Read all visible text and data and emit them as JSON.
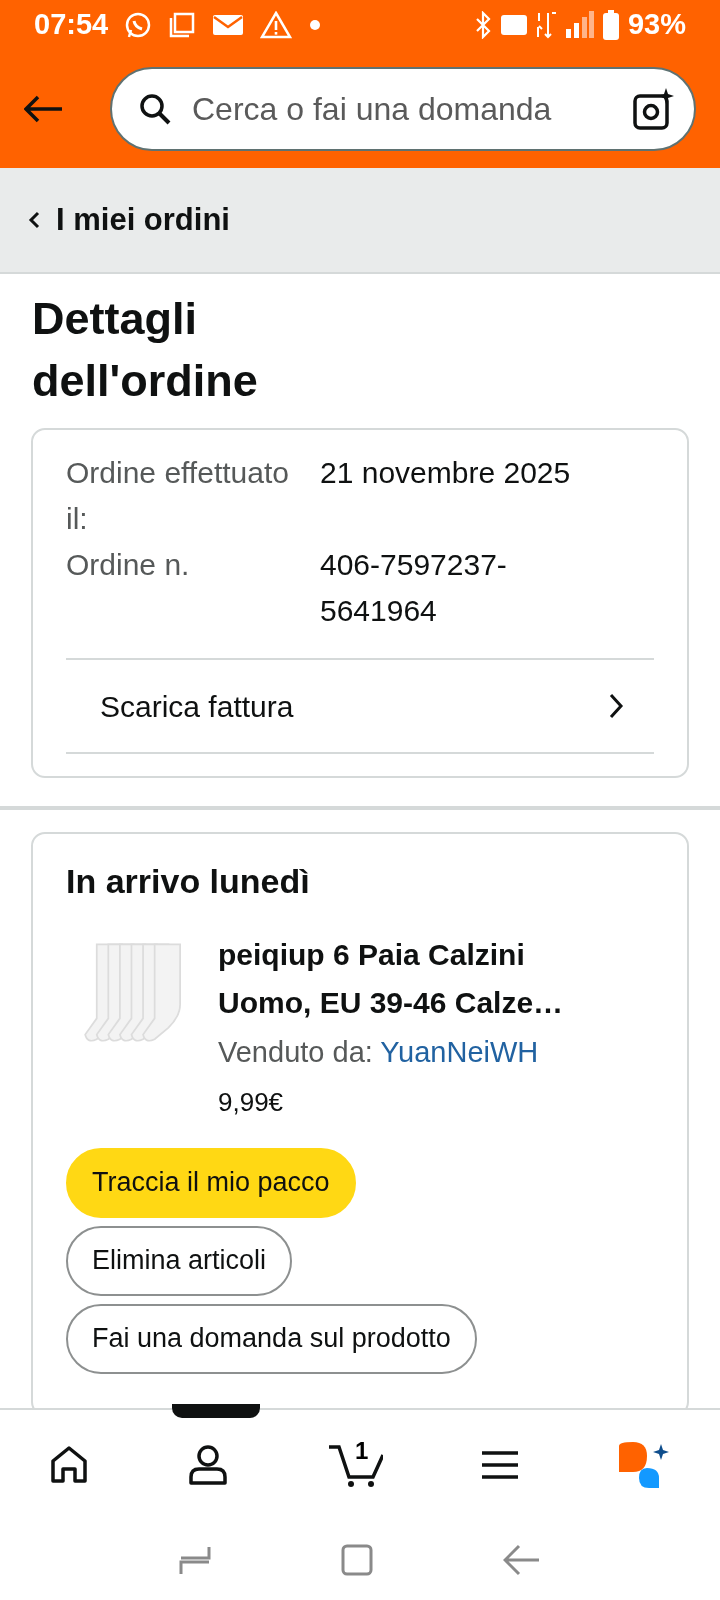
{
  "status_bar": {
    "time": "07:54",
    "battery": "93%"
  },
  "search": {
    "placeholder": "Cerca o fai una domanda"
  },
  "breadcrumb": {
    "label": "I miei ordini"
  },
  "page_title": "Dettagli dell'ordine",
  "order_summary": {
    "fields": [
      {
        "label": "Ordine effettuato il:",
        "value": "21 novembre 2025"
      },
      {
        "label": "Ordine n.",
        "value": "406-7597237-5641964"
      }
    ],
    "invoice_link": "Scarica fattura"
  },
  "shipment": {
    "heading": "In arrivo lunedì",
    "item": {
      "kind": "picture",
      "title": "peiqiup 6 Paia Calzini Uomo, EU 39-46 Calze…",
      "seller_label": "Venduto da:",
      "seller": "YuanNeiWH",
      "price": "9,99€"
    },
    "actions": [
      {
        "label": "Traccia il mio pacco",
        "kind": "primary"
      },
      {
        "label": "Elimina articoli",
        "kind": "secondary"
      },
      {
        "label": "Fai una domanda sul prodotto",
        "kind": "secondary"
      }
    ]
  },
  "bottom_nav": {
    "cart_count": "1"
  }
}
